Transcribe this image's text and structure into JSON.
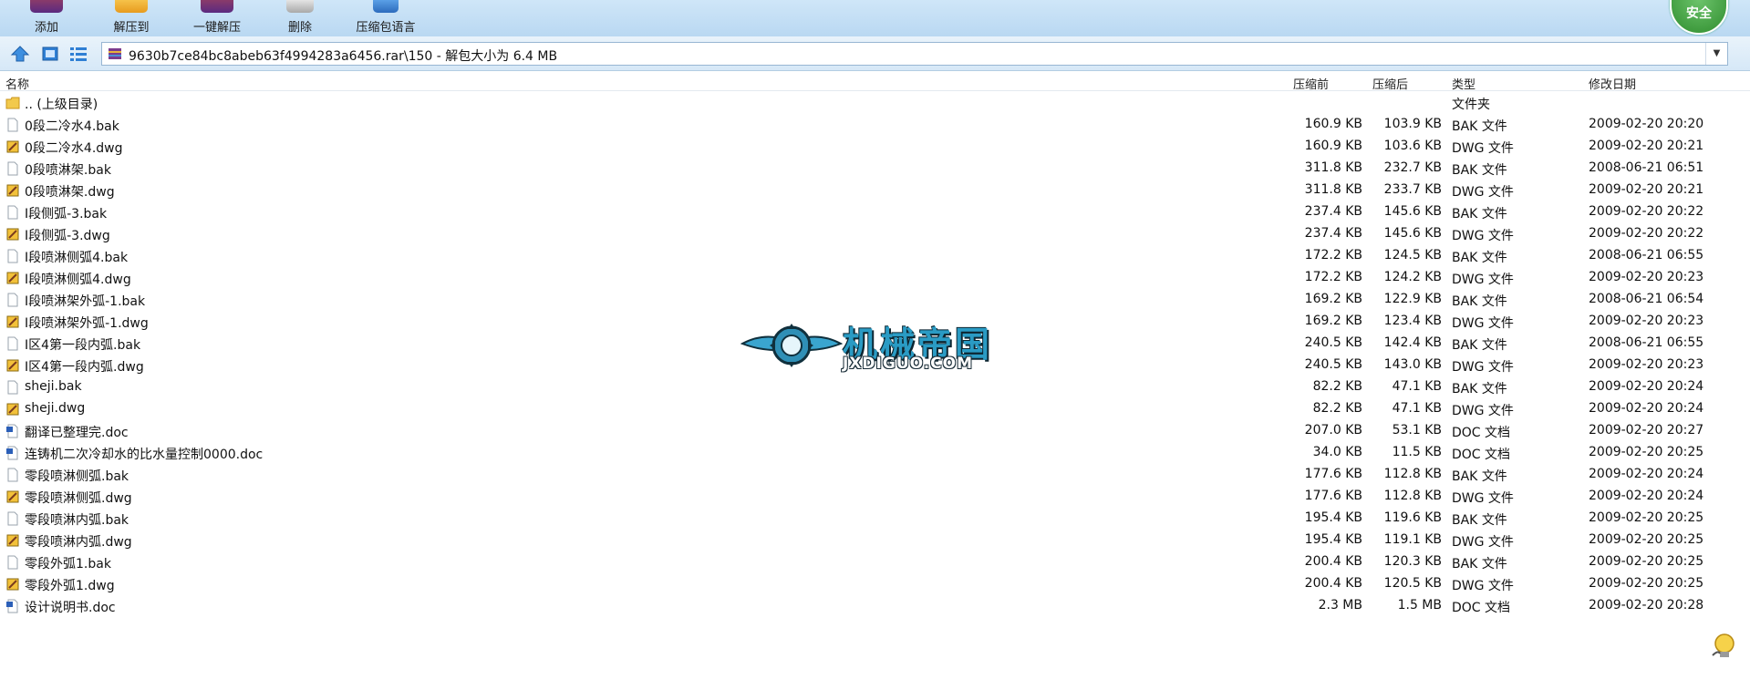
{
  "toolbar": {
    "buttons": [
      {
        "label": "添加"
      },
      {
        "label": "解压到"
      },
      {
        "label": "一键解压"
      },
      {
        "label": "删除"
      },
      {
        "label": "压缩包语言"
      }
    ],
    "shield_label": "安全"
  },
  "address": {
    "path": "9630b7ce84bc8abeb63f4994283a6456.rar\\150 - 解包大小为 6.4 MB"
  },
  "columns": {
    "name": "名称",
    "before": "压缩前",
    "after": "压缩后",
    "type": "类型",
    "date": "修改日期"
  },
  "files": [
    {
      "name": ".. (上级目录)",
      "before": "",
      "after": "",
      "type": "文件夹",
      "date": "",
      "icon": "folder-icon"
    },
    {
      "name": "0段二冷水4.bak",
      "before": "160.9 KB",
      "after": "103.9 KB",
      "type": "BAK 文件",
      "date": "2009-02-20 20:20",
      "icon": "file-icon"
    },
    {
      "name": "0段二冷水4.dwg",
      "before": "160.9 KB",
      "after": "103.6 KB",
      "type": "DWG 文件",
      "date": "2009-02-20 20:21",
      "icon": "dwg-file-icon"
    },
    {
      "name": "0段喷淋架.bak",
      "before": "311.8 KB",
      "after": "232.7 KB",
      "type": "BAK 文件",
      "date": "2008-06-21 06:51",
      "icon": "file-icon"
    },
    {
      "name": "0段喷淋架.dwg",
      "before": "311.8 KB",
      "after": "233.7 KB",
      "type": "DWG 文件",
      "date": "2009-02-20 20:21",
      "icon": "dwg-file-icon"
    },
    {
      "name": "Ⅰ段侧弧-3.bak",
      "before": "237.4 KB",
      "after": "145.6 KB",
      "type": "BAK 文件",
      "date": "2009-02-20 20:22",
      "icon": "file-icon"
    },
    {
      "name": "Ⅰ段侧弧-3.dwg",
      "before": "237.4 KB",
      "after": "145.6 KB",
      "type": "DWG 文件",
      "date": "2009-02-20 20:22",
      "icon": "dwg-file-icon"
    },
    {
      "name": "Ⅰ段喷淋侧弧4.bak",
      "before": "172.2 KB",
      "after": "124.5 KB",
      "type": "BAK 文件",
      "date": "2008-06-21 06:55",
      "icon": "file-icon"
    },
    {
      "name": "Ⅰ段喷淋侧弧4.dwg",
      "before": "172.2 KB",
      "after": "124.2 KB",
      "type": "DWG 文件",
      "date": "2009-02-20 20:23",
      "icon": "dwg-file-icon"
    },
    {
      "name": "Ⅰ段喷淋架外弧-1.bak",
      "before": "169.2 KB",
      "after": "122.9 KB",
      "type": "BAK 文件",
      "date": "2008-06-21 06:54",
      "icon": "file-icon"
    },
    {
      "name": "Ⅰ段喷淋架外弧-1.dwg",
      "before": "169.2 KB",
      "after": "123.4 KB",
      "type": "DWG 文件",
      "date": "2009-02-20 20:23",
      "icon": "dwg-file-icon"
    },
    {
      "name": "Ⅰ区4第一段内弧.bak",
      "before": "240.5 KB",
      "after": "142.4 KB",
      "type": "BAK 文件",
      "date": "2008-06-21 06:55",
      "icon": "file-icon"
    },
    {
      "name": "Ⅰ区4第一段内弧.dwg",
      "before": "240.5 KB",
      "after": "143.0 KB",
      "type": "DWG 文件",
      "date": "2009-02-20 20:23",
      "icon": "dwg-file-icon"
    },
    {
      "name": "sheji.bak",
      "before": "82.2 KB",
      "after": "47.1 KB",
      "type": "BAK 文件",
      "date": "2009-02-20 20:24",
      "icon": "file-icon"
    },
    {
      "name": "sheji.dwg",
      "before": "82.2 KB",
      "after": "47.1 KB",
      "type": "DWG 文件",
      "date": "2009-02-20 20:24",
      "icon": "dwg-file-icon"
    },
    {
      "name": "翻译已整理完.doc",
      "before": "207.0 KB",
      "after": "53.1 KB",
      "type": "DOC 文档",
      "date": "2009-02-20 20:27",
      "icon": "doc-file-icon"
    },
    {
      "name": "连铸机二次冷却水的比水量控制0000.doc",
      "before": "34.0 KB",
      "after": "11.5 KB",
      "type": "DOC 文档",
      "date": "2009-02-20 20:25",
      "icon": "doc-file-icon"
    },
    {
      "name": "零段喷淋侧弧.bak",
      "before": "177.6 KB",
      "after": "112.8 KB",
      "type": "BAK 文件",
      "date": "2009-02-20 20:24",
      "icon": "file-icon"
    },
    {
      "name": "零段喷淋侧弧.dwg",
      "before": "177.6 KB",
      "after": "112.8 KB",
      "type": "DWG 文件",
      "date": "2009-02-20 20:24",
      "icon": "dwg-file-icon"
    },
    {
      "name": "零段喷淋内弧.bak",
      "before": "195.4 KB",
      "after": "119.6 KB",
      "type": "BAK 文件",
      "date": "2009-02-20 20:25",
      "icon": "file-icon"
    },
    {
      "name": "零段喷淋内弧.dwg",
      "before": "195.4 KB",
      "after": "119.1 KB",
      "type": "DWG 文件",
      "date": "2009-02-20 20:25",
      "icon": "dwg-file-icon"
    },
    {
      "name": "零段外弧1.bak",
      "before": "200.4 KB",
      "after": "120.3 KB",
      "type": "BAK 文件",
      "date": "2009-02-20 20:25",
      "icon": "file-icon"
    },
    {
      "name": "零段外弧1.dwg",
      "before": "200.4 KB",
      "after": "120.5 KB",
      "type": "DWG 文件",
      "date": "2009-02-20 20:25",
      "icon": "dwg-file-icon"
    },
    {
      "name": "设计说明书.doc",
      "before": "2.3 MB",
      "after": "1.5 MB",
      "type": "DOC 文档",
      "date": "2009-02-20 20:28",
      "icon": "doc-file-icon"
    }
  ],
  "watermark": {
    "name": "机械帝国",
    "url": "JXDIGUO.COM"
  }
}
